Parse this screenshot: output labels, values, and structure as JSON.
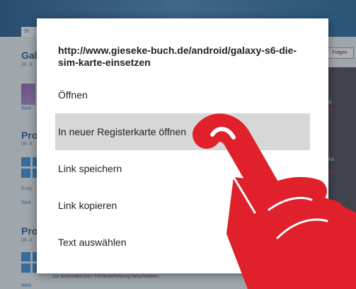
{
  "dialog": {
    "url": "http://www.gieseke-buch.de/android/galaxy-s6-die-sim-karte-einsetzen",
    "items": [
      {
        "label": "Öffnen"
      },
      {
        "label": "In neuer Registerkarte öffnen"
      },
      {
        "label": "Link speichern"
      },
      {
        "label": "Link kopieren"
      },
      {
        "label": "Text auswählen"
      }
    ],
    "highlighted_index": 1
  },
  "background": {
    "tab_label": "St",
    "heading_1": "Gal",
    "date_1": "30. A",
    "link_1": "Weit",
    "heading_2": "Pro",
    "date_2": "09. A",
    "text_2": "Krag",
    "link_2": "Weit",
    "heading_3": "Pro",
    "date_3": "09. A",
    "follow_button": "Folgen",
    "right_texts": [
      "3h",
      "topft",
      "ilows",
      "nde",
      "6 Mai",
      "rseulV",
      "nde"
    ],
    "footer_text": "zur automatischen Fehlerbehebung beschrieben.",
    "link_4": "Weit"
  },
  "colors": {
    "highlight": "#d7d7d7",
    "hand_red": "#e0202a",
    "dialog_bg": "#ffffff"
  }
}
